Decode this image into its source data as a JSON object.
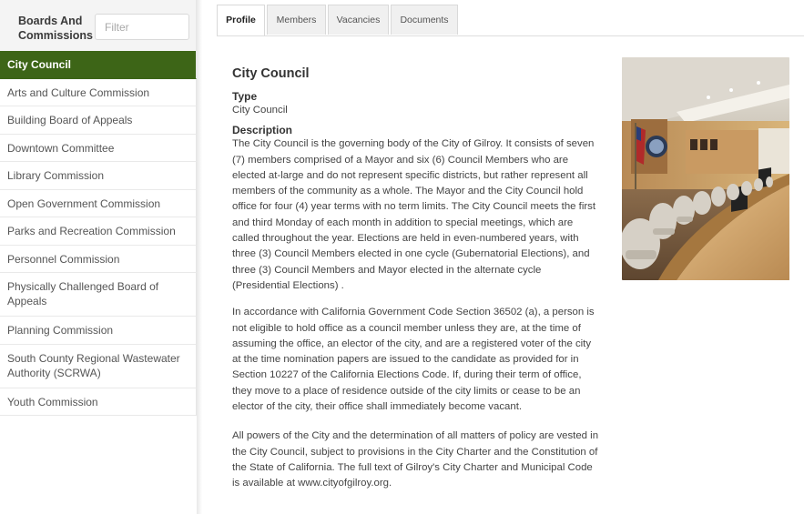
{
  "sidebar": {
    "title": "Boards And Commissions",
    "filter_placeholder": "Filter",
    "items": [
      {
        "label": "City Council"
      },
      {
        "label": "Arts and Culture Commission"
      },
      {
        "label": "Building Board of Appeals"
      },
      {
        "label": "Downtown Committee"
      },
      {
        "label": "Library Commission"
      },
      {
        "label": "Open Government Commission"
      },
      {
        "label": "Parks and Recreation Commission"
      },
      {
        "label": "Personnel Commission"
      },
      {
        "label": "Physically Challenged Board of Appeals"
      },
      {
        "label": "Planning Commission"
      },
      {
        "label": "South County Regional Wastewater Authority (SCRWA)"
      },
      {
        "label": "Youth Commission"
      }
    ],
    "active_color": "#3d6517"
  },
  "tabs": [
    {
      "label": "Profile"
    },
    {
      "label": "Members"
    },
    {
      "label": "Vacancies"
    },
    {
      "label": "Documents"
    }
  ],
  "main": {
    "title": "City Council",
    "type_label": "Type",
    "type_value": "City Council",
    "description_label": "Description",
    "paragraphs": [
      "The City Council is the governing body of the City of Gilroy. It consists of seven (7) members comprised of a Mayor and six (6) Council Members who are elected at-large and do not represent specific districts, but rather represent all members of the community as a whole. The Mayor and the City Council hold office for four (4) year terms with no term limits. The City Council meets the first and third Monday of each month in addition to special meetings, which are called throughout the year. Elections are held in even-numbered years, with three (3) Council Members elected in one cycle (Gubernatorial Elections), and three (3) Council Members and Mayor elected in the alternate cycle (Presidential Elections) .",
      "In accordance with California Government Code Section 36502 (a), a person is not eligible to hold office as a council member unless they are, at the time of assuming the office, an elector of the city, and are a registered voter of the city at the time nomination papers are issued to the candidate as provided for in Section 10227 of the California Elections Code. If, during their term of office, they move to a place of residence outside of the city limits or cease to be an elector of the city, their office shall immediately become vacant.",
      "All powers of the City and the determination of all matters of policy are vested in the City Council, subject to provisions in the City Charter and the Constitution of the State of California. The full text of Gilroy's City Charter and Municipal Code is available at www.cityofgilroy.org."
    ]
  }
}
